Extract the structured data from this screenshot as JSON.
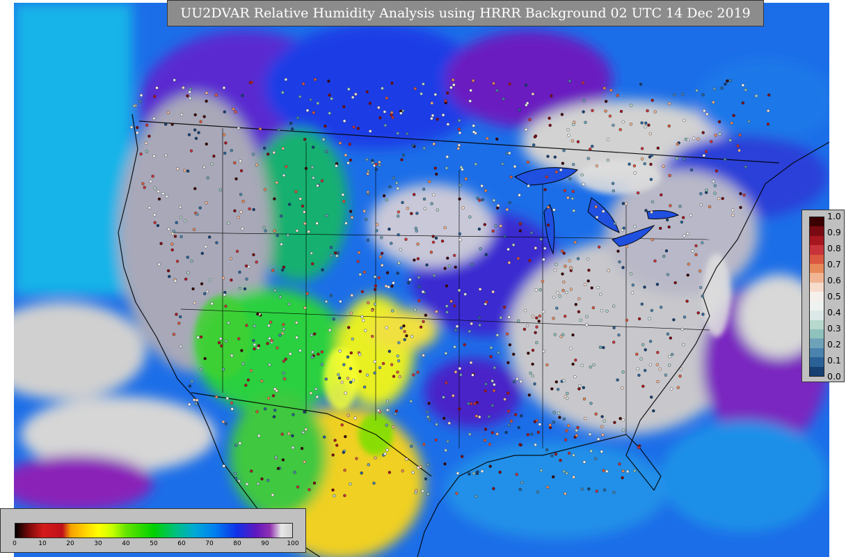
{
  "title": "UU2DVAR Relative Humidity Analysis using HRRR Background 02 UTC 14 Dec 2019",
  "obs_colorbar": {
    "ticks": [
      "1.0",
      "0.9",
      "0.8",
      "0.7",
      "0.6",
      "0.5",
      "0.4",
      "0.3",
      "0.2",
      "0.1",
      "0.0"
    ],
    "colors": [
      "#3b0000",
      "#7a0a12",
      "#a5161f",
      "#c8323a",
      "#d9583f",
      "#e8895a",
      "#f1b593",
      "#f8dccb",
      "#f5f0ec",
      "#eef2f1",
      "#dde9e8",
      "#b7d8cc",
      "#8fc2bd",
      "#6ea2b8",
      "#4a83ad",
      "#2a6297",
      "#163f72"
    ]
  },
  "rh_colorbar": {
    "ticks": [
      "0",
      "10",
      "20",
      "30",
      "40",
      "50",
      "60",
      "70",
      "80",
      "90",
      "100"
    ],
    "stops": [
      {
        "v": 0,
        "color": "#000000"
      },
      {
        "v": 5,
        "color": "#7a0a0a"
      },
      {
        "v": 10,
        "color": "#d31a1a"
      },
      {
        "v": 17,
        "color": "#c0101a"
      },
      {
        "v": 20,
        "color": "#f5a000"
      },
      {
        "v": 25,
        "color": "#ffd000"
      },
      {
        "v": 30,
        "color": "#ffff00"
      },
      {
        "v": 35,
        "color": "#c8ff00"
      },
      {
        "v": 40,
        "color": "#64e400"
      },
      {
        "v": 50,
        "color": "#00d000"
      },
      {
        "v": 58,
        "color": "#00c080"
      },
      {
        "v": 65,
        "color": "#00a8d8"
      },
      {
        "v": 72,
        "color": "#0080f0"
      },
      {
        "v": 80,
        "color": "#1030e8"
      },
      {
        "v": 87,
        "color": "#6018c0"
      },
      {
        "v": 92,
        "color": "#9030b0"
      },
      {
        "v": 96,
        "color": "#e8e8e8"
      },
      {
        "v": 100,
        "color": "#d0d0d0"
      }
    ]
  }
}
